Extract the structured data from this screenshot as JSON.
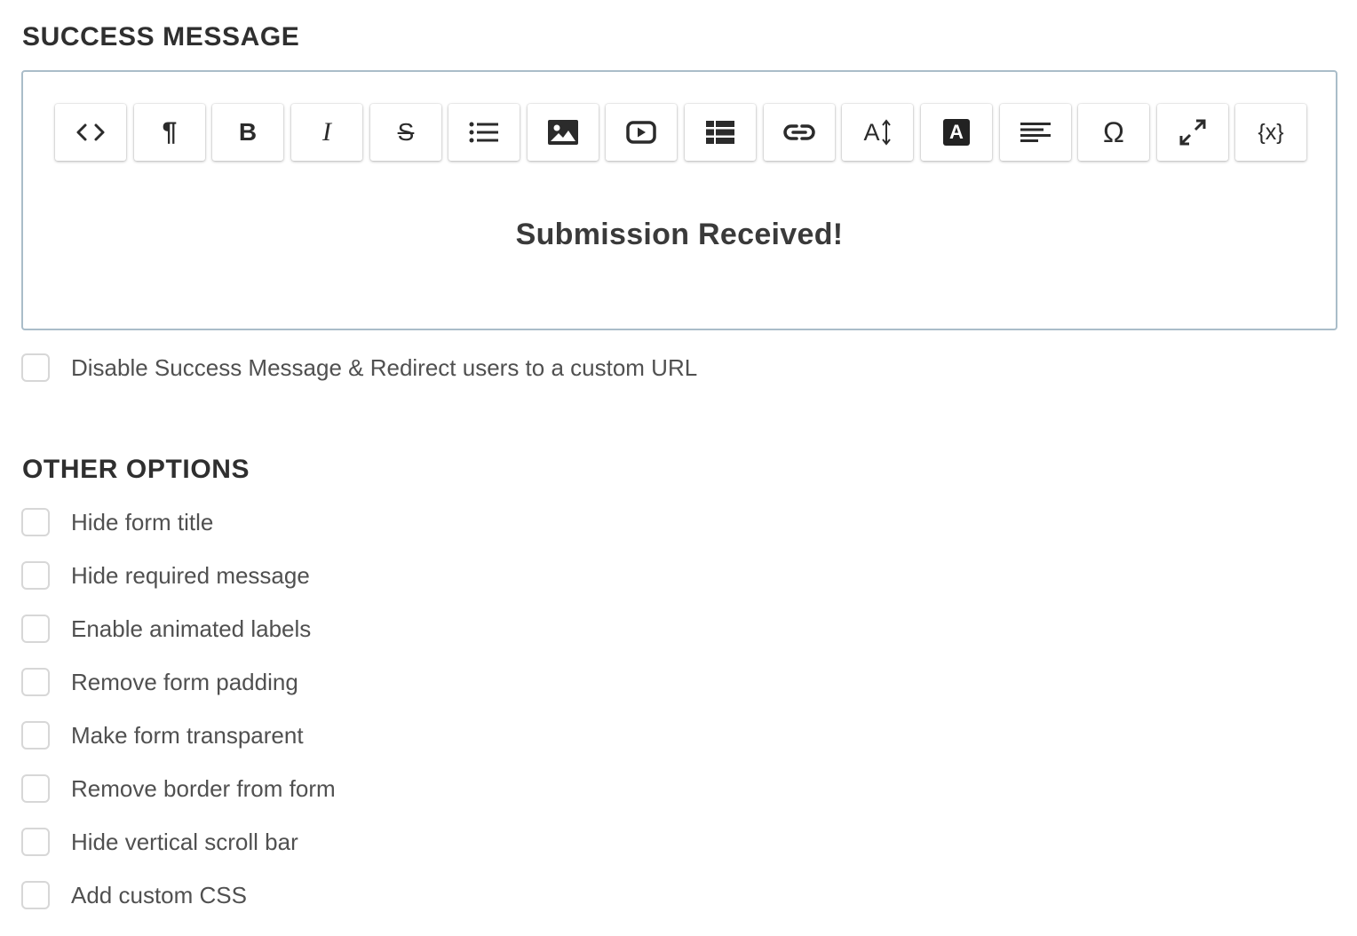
{
  "success_section": {
    "title": "SUCCESS MESSAGE",
    "toolbar": [
      {
        "icon": "code-view-icon",
        "text": ""
      },
      {
        "icon": "paragraph-icon",
        "text": "¶"
      },
      {
        "icon": "bold-icon",
        "text": "B"
      },
      {
        "icon": "italic-icon",
        "text": "I"
      },
      {
        "icon": "strikethrough-icon",
        "text": "S"
      },
      {
        "icon": "bulleted-list-icon",
        "text": ""
      },
      {
        "icon": "insert-image-icon",
        "text": ""
      },
      {
        "icon": "insert-video-icon",
        "text": ""
      },
      {
        "icon": "insert-table-icon",
        "text": ""
      },
      {
        "icon": "insert-link-icon",
        "text": ""
      },
      {
        "icon": "font-size-icon",
        "text": "A"
      },
      {
        "icon": "text-color-icon",
        "text": "A"
      },
      {
        "icon": "align-left-icon",
        "text": ""
      },
      {
        "icon": "special-characters-icon",
        "text": "Ω"
      },
      {
        "icon": "fullscreen-icon",
        "text": ""
      },
      {
        "icon": "insert-variable-icon",
        "text": "{x}"
      }
    ],
    "content": "Submission Received!",
    "disable_option": {
      "label": "Disable Success Message & Redirect users to a custom URL",
      "checked": false
    }
  },
  "other_section": {
    "title": "OTHER OPTIONS",
    "options": [
      {
        "label": "Hide form title",
        "checked": false
      },
      {
        "label": "Hide required message",
        "checked": false
      },
      {
        "label": "Enable animated labels",
        "checked": false
      },
      {
        "label": "Remove form padding",
        "checked": false
      },
      {
        "label": "Make form transparent",
        "checked": false
      },
      {
        "label": "Remove border from form",
        "checked": false
      },
      {
        "label": "Hide vertical scroll bar",
        "checked": false
      },
      {
        "label": "Add custom CSS",
        "checked": false
      }
    ]
  },
  "colors": {
    "editor_border": "#aabdc9",
    "checkbox_border": "#d7d7d7",
    "heading_text": "#2f2f2f",
    "label_text": "#505050"
  }
}
